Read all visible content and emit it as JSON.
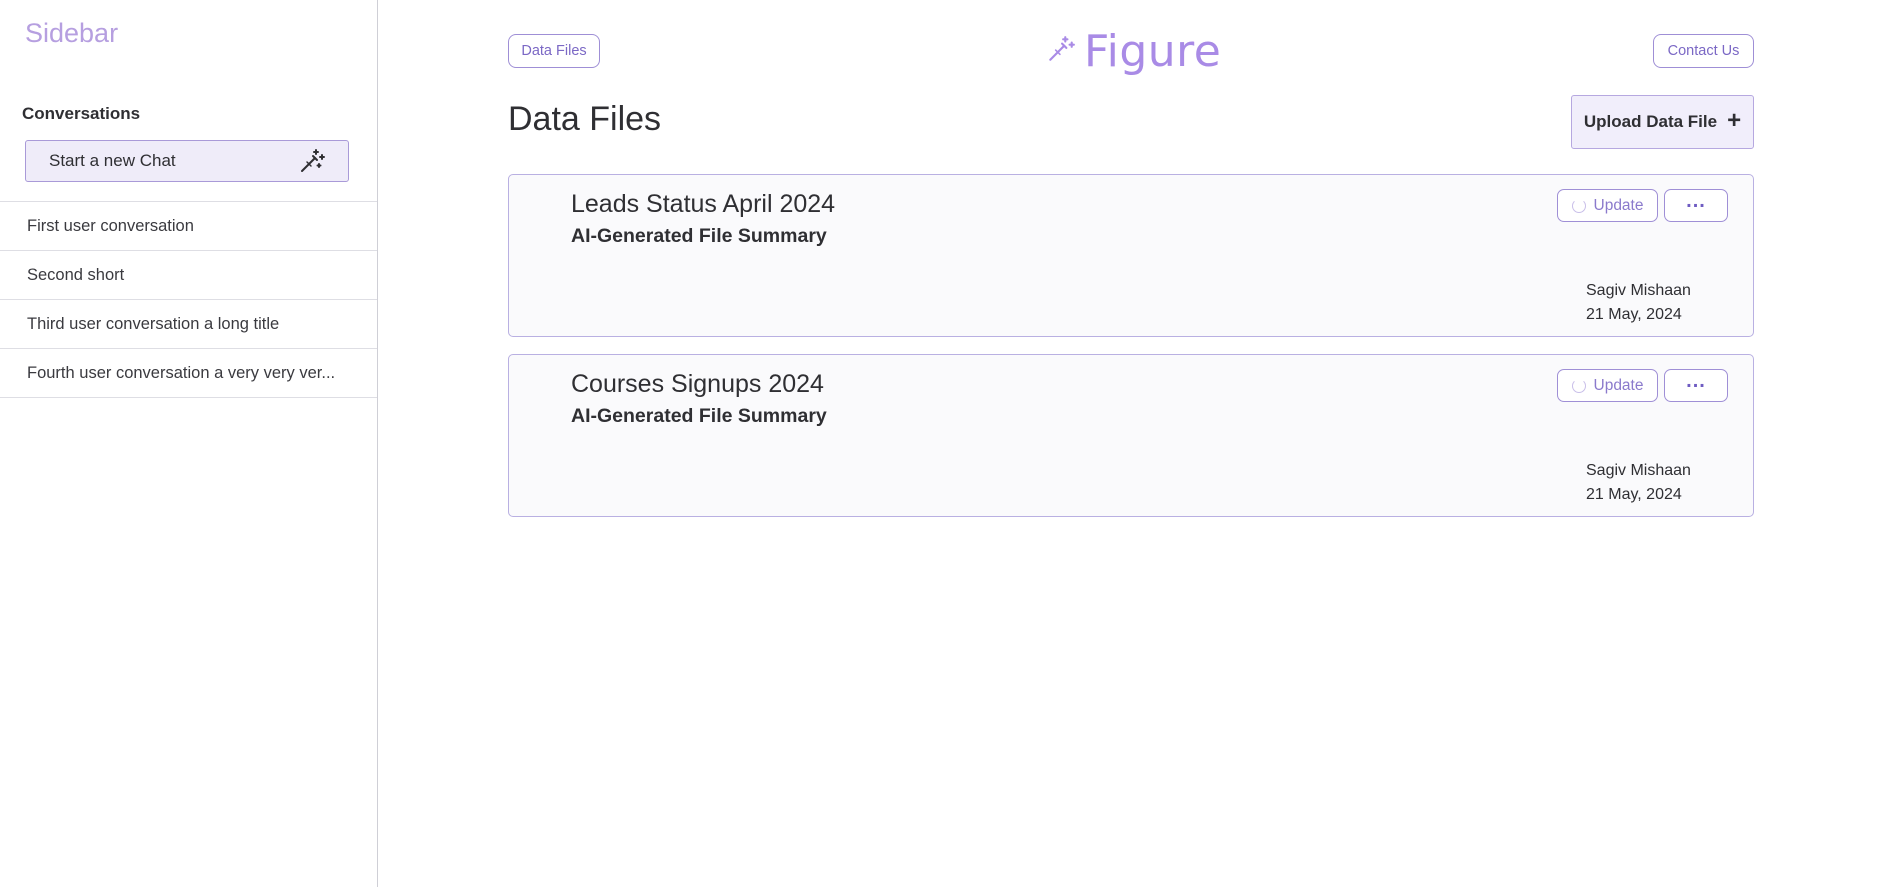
{
  "sidebar": {
    "title": "Sidebar",
    "section_label": "Conversations",
    "new_chat_label": "Start a new Chat",
    "new_chat_icon": "magic-wand-icon",
    "conversations": [
      "First user conversation",
      "Second short",
      "Third user conversation a long title",
      "Fourth user conversation a very very ver..."
    ]
  },
  "header": {
    "data_files_link": "Data Files",
    "logo_text": "Figure",
    "logo_icon": "magic-wand-icon",
    "contact_link": "Contact Us"
  },
  "main": {
    "page_title": "Data Files",
    "upload_label": "Upload Data File",
    "upload_icon": "plus-icon",
    "files": [
      {
        "title": "Leads Status April 2024",
        "subtitle": "AI-Generated File Summary",
        "update_label": "Update",
        "more_label": "...",
        "author": "Sagiv Mishaan",
        "date": "21 May, 2024"
      },
      {
        "title": "Courses Signups 2024",
        "subtitle": "AI-Generated File Summary",
        "update_label": "Update",
        "more_label": "...",
        "author": "Sagiv Mishaan",
        "date": "21 May, 2024"
      }
    ]
  },
  "colors": {
    "accent": "#a98be6",
    "accent_border": "#9f8fd6",
    "button_bg": "#efecf9",
    "text": "#2f2f33"
  }
}
